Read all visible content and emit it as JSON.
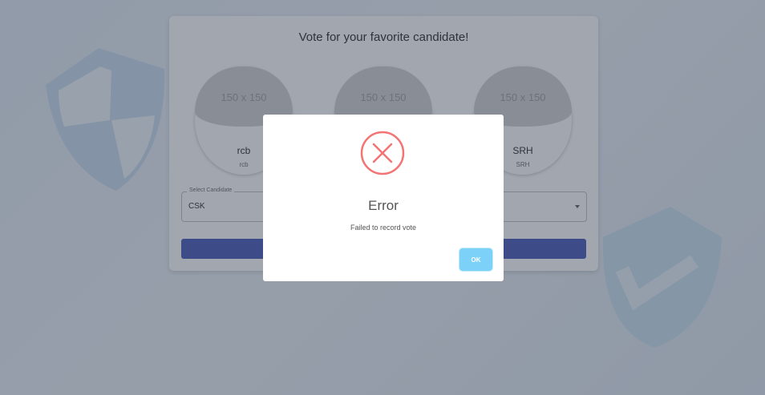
{
  "page": {
    "title": "Vote for your favorite candidate!"
  },
  "candidates": [
    {
      "photo_placeholder": "150 x 150",
      "name": "rcb",
      "party": "rcb"
    },
    {
      "photo_placeholder": "150 x 150",
      "name": "",
      "party": ""
    },
    {
      "photo_placeholder": "150 x 150",
      "name": "SRH",
      "party": "SRH"
    }
  ],
  "select": {
    "label": "Select Candidate",
    "value": "CSK"
  },
  "dialog": {
    "icon": "error-x-icon",
    "title": "Error",
    "message": "Failed to record vote",
    "ok_label": "OK"
  },
  "colors": {
    "primary": "#3f51b5",
    "error": "#f27474",
    "ok_button": "#7cd1f9"
  }
}
